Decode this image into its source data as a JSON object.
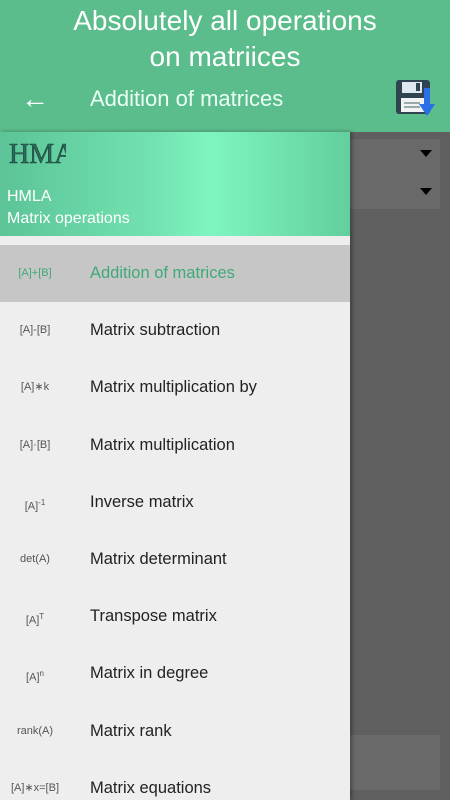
{
  "promo": {
    "line1": "Absolutely all operations",
    "line2": "on matriices"
  },
  "appbar": {
    "back_icon": "←",
    "title": "Addition of matrices",
    "save_icon": "save-download-icon"
  },
  "drawer": {
    "logo_text": "HMA",
    "app_name": "HMLA",
    "subtitle": "Matrix operations",
    "items": [
      {
        "icon": "[A]+[B]",
        "label": "Addition of matrices",
        "active": true
      },
      {
        "icon": "[A]-[B]",
        "label": "Matrix subtraction"
      },
      {
        "icon": "[A]∗k",
        "label": "Matrix multiplication by"
      },
      {
        "icon": "[A]·[B]",
        "label": "Matrix multiplication"
      },
      {
        "icon": "[A]",
        "sup": "-1",
        "label": "Inverse matrix"
      },
      {
        "icon": "det(A)",
        "label": "Matrix determinant"
      },
      {
        "icon": "[A]",
        "sup": "T",
        "label": "Transpose matrix"
      },
      {
        "icon": "[A]",
        "sup": "n",
        "label": "Matrix in degree"
      },
      {
        "icon": "rank(A)",
        "label": "Matrix rank"
      },
      {
        "icon": "[A]∗x=[B]",
        "label": "Matrix equations"
      }
    ]
  },
  "colors": {
    "appbar": "#5cbd8c",
    "accent": "#3faa78",
    "scrim": "#5f5f5f"
  }
}
